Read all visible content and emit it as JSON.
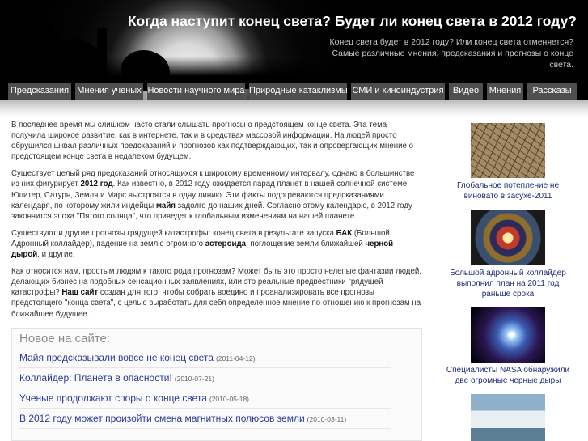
{
  "header": {
    "title": "Когда наступит конец света? Будет ли конец света в 2012 году?",
    "subtitle": "Конец света будет в 2012 году? Или конец света отменяется? Самые различные мнения, предсказания и прогнозы о конце света."
  },
  "nav": {
    "items": [
      {
        "label": "Предсказания"
      },
      {
        "label": "Мнения ученых"
      },
      {
        "label": "Новости научного мира"
      },
      {
        "label": "Природные катаклизмы"
      },
      {
        "label": "СМИ и киноиндустрия"
      },
      {
        "label": "Видео"
      },
      {
        "label": "Мнения"
      },
      {
        "label": "Рассказы"
      }
    ]
  },
  "article": {
    "p1": "В последнее время мы слишком часто стали слышать прогнозы о предстоящем конце света. Эта тема получила широкое развитие, как в интернете, так и в средствах массовой информации. На людей просто обрушился шквал различных предсказаний и прогнозов как подтверждающих, так и опровергающих мнение о предстоящем конце света в недалеком будущем.",
    "p2_a": "Существует целый ряд предсказаний относящихся к широкому временному интервалу, однако в большинстве из них фигурирует ",
    "p2_b": "2012 год",
    "p2_c": ". Как известно, в 2012 году ожидается парад планет в нашей солнечной системе Юпитер, Сатурн, Земля и Марс выстроятся в одну линию. Эти факты подогреваются предсказаниями календаря, по которому жили индейцы ",
    "p2_d": "майя",
    "p2_e": " задолго до наших дней. Согласно этому календарю, в 2012 году закончится эпоха \"Пятого солнца\", что приведет к глобальным изменениям на нашей планете.",
    "p3_a": "Существуют и другие прогнозы грядущей катастрофы: конец света в результате запуска ",
    "p3_b": "БАК",
    "p3_c": " (Большой Адронный коллайдер), падение на землю огромного ",
    "p3_d": "астероида",
    "p3_e": ", поглощение земли ближайшей ",
    "p3_f": "черной дырой",
    "p3_g": ", и другие.",
    "p4_a": "Как относится нам, простым людям к такого рода прогнозам? Может быть это просто нелепые фантазии людей, делающих бизнес на подобных сенсационных заявлениях, или это реальные предвестники грядущей катастрофы? ",
    "p4_b": "Наш сайт",
    "p4_c": " создан для того, чтобы собрать воедино и проанализировать все прогнозы предстоящего \"конца света\", с целью выработать для себя определенное мнение по отношению к прогнозам на ближайшее будущее."
  },
  "news": {
    "heading": "Новое на сайте:",
    "items": [
      {
        "title": "Майя предсказывали вовсе не конец света",
        "date": "(2011-04-12)"
      },
      {
        "title": "Коллайдер: Планета в опасности!",
        "date": "(2010-07-21)"
      },
      {
        "title": "Ученые продолжают споры о конце света",
        "date": "(2010-05-18)"
      },
      {
        "title": "В 2012 году может произойти смена магнитных полюсов земли",
        "date": "(2010-03-11)"
      }
    ]
  },
  "sidebar": {
    "cards": [
      {
        "caption": "Глобальное потепление не виновато в засухе-2011",
        "icon": "cracked-earth-image"
      },
      {
        "caption": "Большой адронный коллайдер выполнил план на 2011 год раньше срока",
        "icon": "collider-image"
      },
      {
        "caption": "Специалисты NASA обнаружили две огромные черные дыры",
        "icon": "nebula-image"
      },
      {
        "caption": "",
        "icon": "iceberg-image"
      }
    ]
  }
}
